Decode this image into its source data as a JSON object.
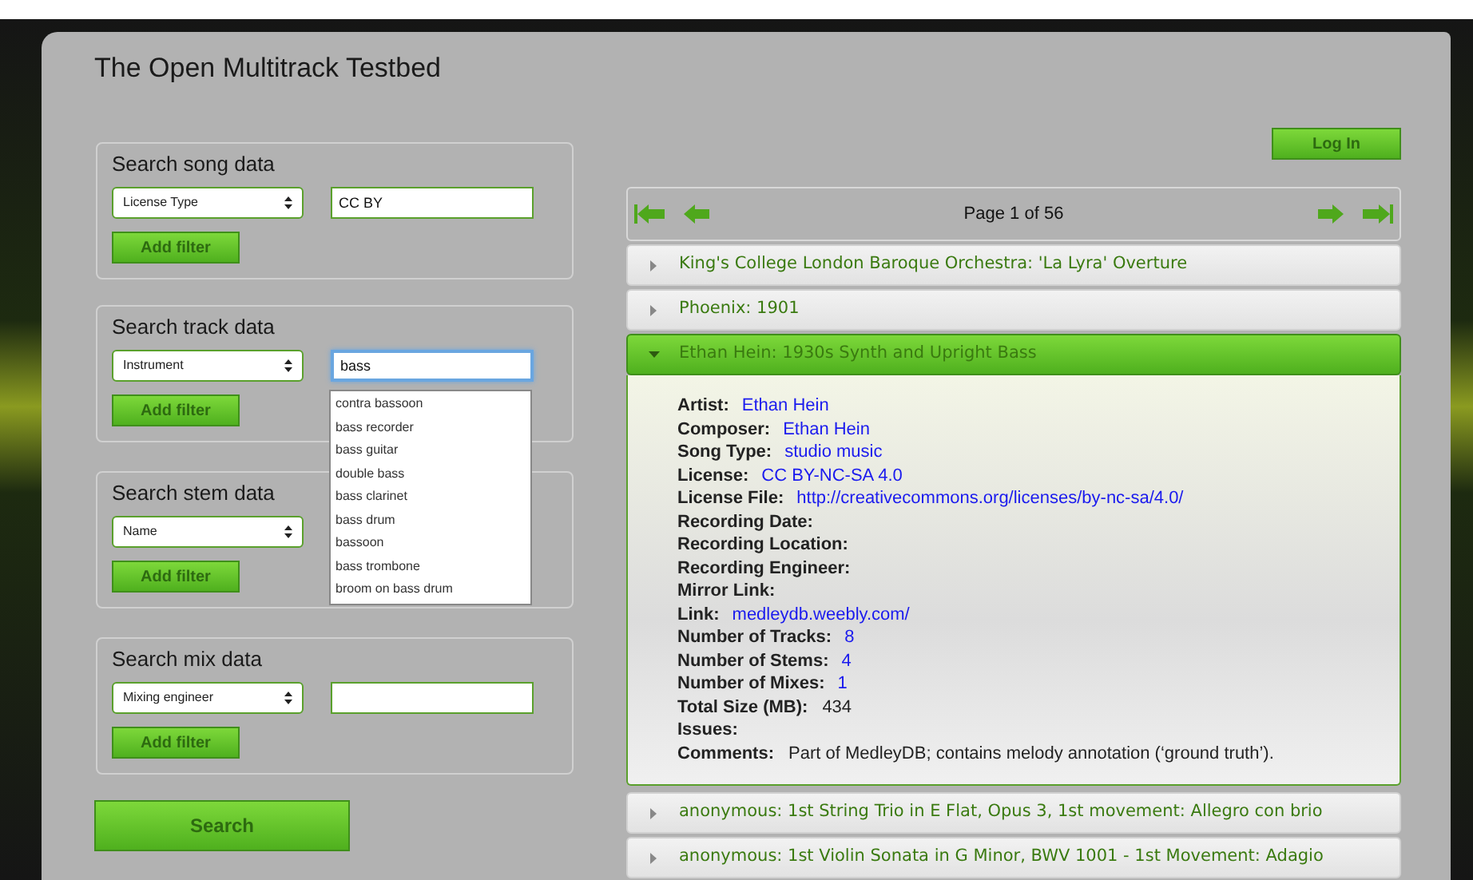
{
  "page_title": "The Open Multitrack Testbed",
  "filter_panels": [
    {
      "title": "Search song data",
      "kind": "select_text",
      "field": "License Type",
      "value": "CC BY",
      "focused": false,
      "button": "Add filter"
    },
    {
      "title": "Search track data",
      "kind": "select_text",
      "field": "Instrument",
      "value": "bass",
      "focused": true,
      "button": "Add filter"
    },
    {
      "title": "Search stem data",
      "kind": "select_only",
      "field": "Name",
      "focused": false,
      "button": "Add filter"
    },
    {
      "title": "Search mix data",
      "kind": "select_text",
      "field": "Mixing engineer",
      "focused": false,
      "button": "Add filter"
    }
  ],
  "autocomplete": {
    "items": [
      "contra bassoon",
      "bass recorder",
      "bass guitar",
      "double bass",
      "bass clarinet",
      "bass drum",
      "bassoon",
      "bass trombone",
      "broom on bass drum"
    ]
  },
  "search_button": "Search",
  "login_button": "Log In",
  "pager": {
    "label": "Page 1 of 56"
  },
  "results": [
    {
      "title": "King's College London Baroque Orchestra: 'La Lyra' Overture",
      "expanded": false
    },
    {
      "title": "Phoenix: 1901",
      "expanded": false
    },
    {
      "title": "Ethan Hein: 1930s Synth and Upright Bass",
      "expanded": true,
      "details": [
        {
          "label": "Artist:",
          "value": "Ethan Hein",
          "kind": "link"
        },
        {
          "label": "Composer:",
          "value": "Ethan Hein",
          "kind": "link"
        },
        {
          "label": "Song Type:",
          "value": "studio music",
          "kind": "link"
        },
        {
          "label": "License:",
          "value": "CC BY-NC-SA 4.0",
          "kind": "link"
        },
        {
          "label": "License File:",
          "value": "http://creativecommons.org/licenses/by-nc-sa/4.0/",
          "kind": "link"
        },
        {
          "label": "Recording Date:"
        },
        {
          "label": "Recording Location:"
        },
        {
          "label": "Recording Engineer:"
        },
        {
          "label": "Mirror Link:"
        },
        {
          "label": "Link:",
          "value": "medleydb.weebly.com/",
          "kind": "link"
        },
        {
          "label": "Number of Tracks:",
          "value": "8",
          "kind": "link"
        },
        {
          "label": "Number of Stems:",
          "value": "4",
          "kind": "link"
        },
        {
          "label": "Number of Mixes:",
          "value": "1",
          "kind": "link"
        },
        {
          "label": "Total Size (MB):",
          "value": "434",
          "kind": "text"
        },
        {
          "label": "Issues:"
        },
        {
          "label": "Comments:",
          "value": "Part of MedleyDB; contains melody annotation (‘ground truth’).",
          "kind": "text"
        }
      ]
    },
    {
      "title": "anonymous: 1st String Trio in E Flat, Opus 3, 1st movement: Allegro con brio",
      "expanded": false
    },
    {
      "title": "anonymous: 1st Violin Sonata in G Minor, BWV 1001 - 1st Movement: Adagio",
      "expanded": false
    }
  ]
}
